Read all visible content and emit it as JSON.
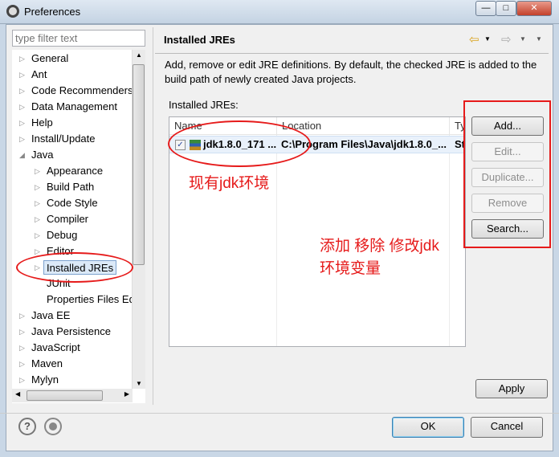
{
  "window": {
    "title": "Preferences",
    "minimize": "—",
    "maximize": "□",
    "close": "✕"
  },
  "filter": {
    "placeholder": "type filter text"
  },
  "tree": [
    {
      "label": "General",
      "level": 0,
      "state": "collapsed"
    },
    {
      "label": "Ant",
      "level": 0,
      "state": "collapsed"
    },
    {
      "label": "Code Recommenders",
      "level": 0,
      "state": "collapsed"
    },
    {
      "label": "Data Management",
      "level": 0,
      "state": "collapsed"
    },
    {
      "label": "Help",
      "level": 0,
      "state": "collapsed"
    },
    {
      "label": "Install/Update",
      "level": 0,
      "state": "collapsed"
    },
    {
      "label": "Java",
      "level": 0,
      "state": "expanded"
    },
    {
      "label": "Appearance",
      "level": 1,
      "state": "collapsed"
    },
    {
      "label": "Build Path",
      "level": 1,
      "state": "collapsed"
    },
    {
      "label": "Code Style",
      "level": 1,
      "state": "collapsed"
    },
    {
      "label": "Compiler",
      "level": 1,
      "state": "collapsed"
    },
    {
      "label": "Debug",
      "level": 1,
      "state": "collapsed"
    },
    {
      "label": "Editor",
      "level": 1,
      "state": "collapsed"
    },
    {
      "label": "Installed JREs",
      "level": 1,
      "state": "collapsed",
      "selected": true
    },
    {
      "label": "JUnit",
      "level": 1,
      "state": "leaf"
    },
    {
      "label": "Properties Files Ed",
      "level": 1,
      "state": "leaf"
    },
    {
      "label": "Java EE",
      "level": 0,
      "state": "collapsed"
    },
    {
      "label": "Java Persistence",
      "level": 0,
      "state": "collapsed"
    },
    {
      "label": "JavaScript",
      "level": 0,
      "state": "collapsed"
    },
    {
      "label": "Maven",
      "level": 0,
      "state": "collapsed"
    },
    {
      "label": "Mylyn",
      "level": 0,
      "state": "collapsed"
    }
  ],
  "page": {
    "title": "Installed JREs",
    "description": "Add, remove or edit JRE definitions. By default, the checked JRE is added to the build path of newly created Java projects.",
    "list_label": "Installed JREs:",
    "columns": [
      "Name",
      "Location",
      "Type"
    ],
    "columns_visible": [
      "Name",
      "Location",
      "Ty"
    ],
    "rows": [
      {
        "checked": true,
        "name": "jdk1.8.0_171 ...",
        "location": "C:\\Program Files\\Java\\jdk1.8.0_...",
        "type": "St"
      }
    ],
    "buttons": {
      "add": "Add...",
      "edit": "Edit...",
      "duplicate": "Duplicate...",
      "remove": "Remove",
      "search": "Search..."
    },
    "apply": "Apply"
  },
  "annotations": {
    "current": "现有jdk环境",
    "actions_line1": "添加 移除 修改jdk",
    "actions_line2": "环境变量"
  },
  "footer": {
    "ok": "OK",
    "cancel": "Cancel"
  },
  "colors": {
    "annotation": "#e61a1a",
    "selection": "#dbe9f8"
  }
}
